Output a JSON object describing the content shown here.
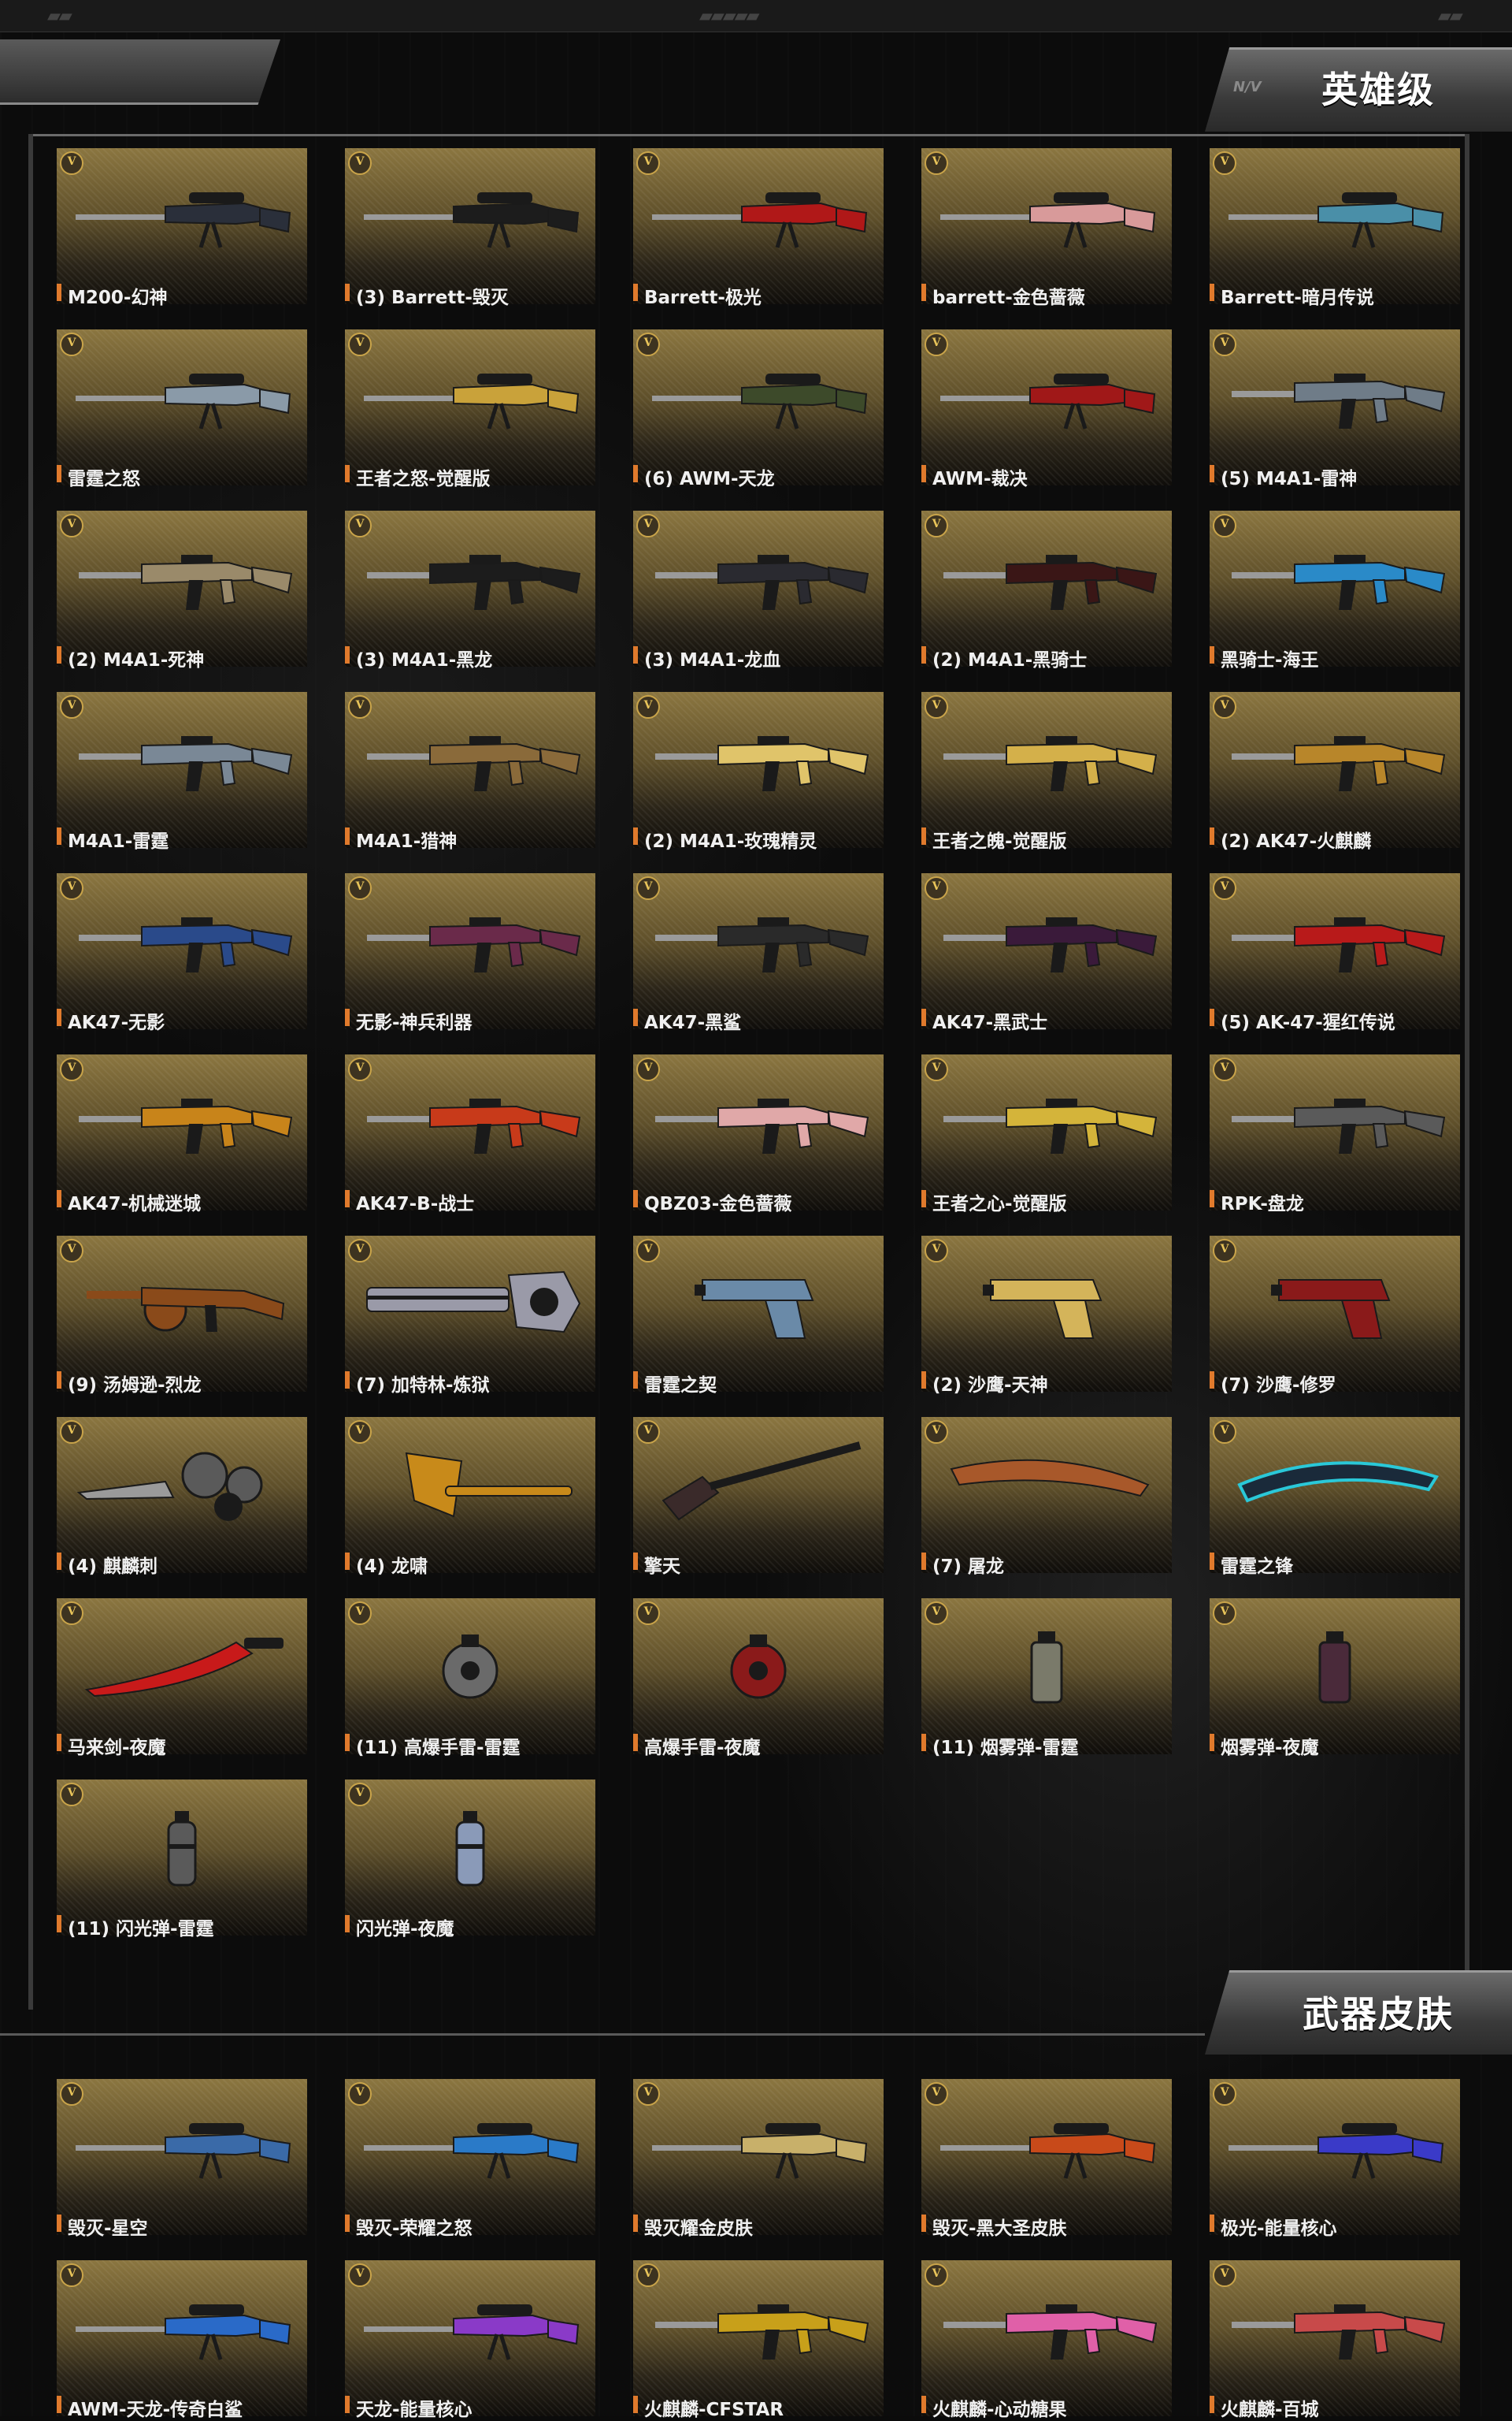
{
  "sections": [
    {
      "title": "英雄级",
      "items": [
        {
          "name": "M200-幻神",
          "icon": "sniper-rifle-icon",
          "color": "#2a2f3a"
        },
        {
          "name": "(3) Barrett-毁灭",
          "icon": "sniper-rifle-icon",
          "color": "#1c1c1c"
        },
        {
          "name": "Barrett-极光",
          "icon": "sniper-rifle-icon",
          "color": "#b01818"
        },
        {
          "name": "barrett-金色蔷薇",
          "icon": "sniper-rifle-icon",
          "color": "#d89a9a"
        },
        {
          "name": "Barrett-暗月传说",
          "icon": "sniper-rifle-icon",
          "color": "#4a8fa8"
        },
        {
          "name": "雷霆之怒",
          "icon": "sniper-rifle-icon",
          "color": "#8a9aa8"
        },
        {
          "name": "王者之怒-觉醒版",
          "icon": "sniper-rifle-icon",
          "color": "#c9a23a"
        },
        {
          "name": "(6) AWM-天龙",
          "icon": "sniper-rifle-icon",
          "color": "#3d4a2a"
        },
        {
          "name": "AWM-裁决",
          "icon": "sniper-rifle-icon",
          "color": "#a01818"
        },
        {
          "name": "(5) M4A1-雷神",
          "icon": "assault-rifle-icon",
          "color": "#6f7c88"
        },
        {
          "name": "(2) M4A1-死神",
          "icon": "assault-rifle-icon",
          "color": "#9a8a6a"
        },
        {
          "name": "(3) M4A1-黑龙",
          "icon": "assault-rifle-icon",
          "color": "#1c1c1c"
        },
        {
          "name": "(3) M4A1-龙血",
          "icon": "assault-rifle-icon",
          "color": "#2a2a30"
        },
        {
          "name": "(2) M4A1-黑骑士",
          "icon": "assault-rifle-icon",
          "color": "#3a1616"
        },
        {
          "name": "黑骑士-海王",
          "icon": "assault-rifle-icon",
          "color": "#2a8ac8"
        },
        {
          "name": "M4A1-雷霆",
          "icon": "assault-rifle-icon",
          "color": "#7a8896"
        },
        {
          "name": "M4A1-猎神",
          "icon": "assault-rifle-icon",
          "color": "#8a6a3a"
        },
        {
          "name": "(2) M4A1-玫瑰精灵",
          "icon": "assault-rifle-icon",
          "color": "#e0c46a"
        },
        {
          "name": "王者之魄-觉醒版",
          "icon": "assault-rifle-icon",
          "color": "#d4b04a"
        },
        {
          "name": "(2) AK47-火麒麟",
          "icon": "assault-rifle-icon",
          "color": "#b8862a"
        },
        {
          "name": "AK47-无影",
          "icon": "assault-rifle-icon",
          "color": "#2a4a8a"
        },
        {
          "name": "无影-神兵利器",
          "icon": "assault-rifle-icon",
          "color": "#6a2a4a"
        },
        {
          "name": "AK47-黑鲨",
          "icon": "assault-rifle-icon",
          "color": "#2a2a2a"
        },
        {
          "name": "AK47-黑武士",
          "icon": "assault-rifle-icon",
          "color": "#3a1a3a"
        },
        {
          "name": "(5) AK-47-猩红传说",
          "icon": "assault-rifle-icon",
          "color": "#b81a1a"
        },
        {
          "name": "AK47-机械迷城",
          "icon": "assault-rifle-icon",
          "color": "#c8841a"
        },
        {
          "name": "AK47-B-战士",
          "icon": "assault-rifle-icon",
          "color": "#c83a1a"
        },
        {
          "name": "QBZ03-金色蔷薇",
          "icon": "assault-rifle-icon",
          "color": "#e0a8a8"
        },
        {
          "name": "王者之心-觉醒版",
          "icon": "assault-rifle-icon",
          "color": "#d4b43a"
        },
        {
          "name": "RPK-盘龙",
          "icon": "assault-rifle-icon",
          "color": "#5a5a5a"
        },
        {
          "name": "(9) 汤姆逊-烈龙",
          "icon": "smg-icon",
          "color": "#8a4a1a"
        },
        {
          "name": "(7) 加特林-炼狱",
          "icon": "gatling-icon",
          "color": "#9a9aa8"
        },
        {
          "name": "雷霆之契",
          "icon": "pistol-icon",
          "color": "#6a8aa8"
        },
        {
          "name": "(2) 沙鹰-天神",
          "icon": "pistol-icon",
          "color": "#d4b45a"
        },
        {
          "name": "(7) 沙鹰-修罗",
          "icon": "pistol-icon",
          "color": "#8a1a1a"
        },
        {
          "name": "(4) 麒麟刺",
          "icon": "knuckle-blade-icon",
          "color": "#5a5a5a"
        },
        {
          "name": "(4) 龙啸",
          "icon": "axe-icon",
          "color": "#c88a1a"
        },
        {
          "name": "擎天",
          "icon": "shovel-icon",
          "color": "#3a2a2a"
        },
        {
          "name": "(7) 屠龙",
          "icon": "machete-icon",
          "color": "#a8582a"
        },
        {
          "name": "雷霆之锋",
          "icon": "curved-blade-icon",
          "color": "#2ac8d8"
        },
        {
          "name": "马来剑-夜魔",
          "icon": "sword-icon",
          "color": "#c81a1a"
        },
        {
          "name": "(11) 高爆手雷-雷霆",
          "icon": "grenade-icon",
          "color": "#6a6a6a"
        },
        {
          "name": "高爆手雷-夜魔",
          "icon": "grenade-icon",
          "color": "#8a1a1a"
        },
        {
          "name": "(11) 烟雾弹-雷霆",
          "icon": "smoke-grenade-icon",
          "color": "#7a7a6a"
        },
        {
          "name": "烟雾弹-夜魔",
          "icon": "smoke-grenade-icon",
          "color": "#4a2a3a"
        },
        {
          "name": "(11) 闪光弹-雷霆",
          "icon": "flashbang-icon",
          "color": "#5a5a5a"
        },
        {
          "name": "闪光弹-夜魔",
          "icon": "flashbang-icon",
          "color": "#8a9ab8"
        }
      ]
    },
    {
      "title": "武器皮肤",
      "items": [
        {
          "name": "毁灭-星空",
          "icon": "sniper-rifle-icon",
          "color": "#3a6aa8"
        },
        {
          "name": "毁灭-荣耀之怒",
          "icon": "sniper-rifle-icon",
          "color": "#2a7ac8"
        },
        {
          "name": "毁灭耀金皮肤",
          "icon": "sniper-rifle-icon",
          "color": "#c8b06a"
        },
        {
          "name": "毁灭-黑大圣皮肤",
          "icon": "sniper-rifle-icon",
          "color": "#c84a1a"
        },
        {
          "name": "极光-能量核心",
          "icon": "sniper-rifle-icon",
          "color": "#3a3ac8"
        },
        {
          "name": "AWM-天龙-传奇白鲨",
          "icon": "sniper-rifle-icon",
          "color": "#2a6ac8"
        },
        {
          "name": "天龙-能量核心",
          "icon": "sniper-rifle-icon",
          "color": "#8a3ac8"
        },
        {
          "name": "火麒麟-CFSTAR",
          "icon": "assault-rifle-icon",
          "color": "#c8a01a"
        },
        {
          "name": "火麒麟-心动糖果",
          "icon": "assault-rifle-icon",
          "color": "#e060a8"
        },
        {
          "name": "火麒麟-百城",
          "icon": "assault-rifle-icon",
          "color": "#c84a4a"
        }
      ]
    }
  ]
}
